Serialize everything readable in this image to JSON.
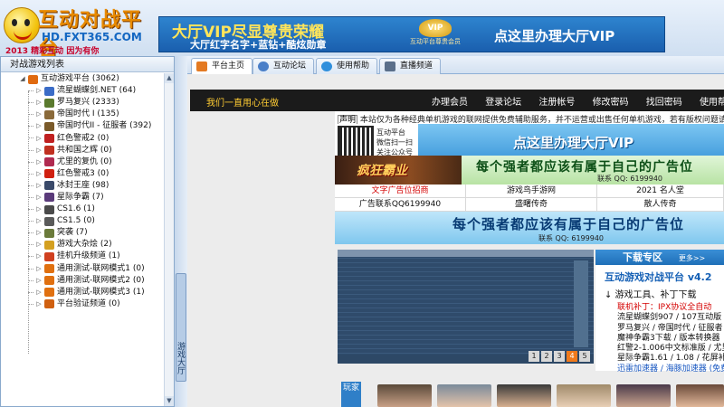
{
  "header": {
    "logo_title": "互动对战平台",
    "logo_domain": "HD.FXT365.COM",
    "logo_slogan": "2013 精彩互动 因为有你",
    "banner_line1": "大厅VIP尽显尊贵荣耀",
    "banner_line2": "大厅红字名字+蓝钻+酷炫勋章",
    "banner_badge_text": "互动平台尊贵会员",
    "banner_badge_mark": "VIP",
    "banner_cta": "点这里办理大厅VIP"
  },
  "left_pane": {
    "title": "对战游戏列表",
    "strip_label": "游戏大厅",
    "root": {
      "label": "互动游戏平台 (3062)"
    },
    "items": [
      {
        "label": "流星蝴蝶剑.NET (64)",
        "icon": "sword-icon",
        "color": "#3b6cc7"
      },
      {
        "label": "罗马复兴 (2333)",
        "icon": "shield-icon",
        "color": "#5a7a2e"
      },
      {
        "label": "帝国时代 I (135)",
        "icon": "castle-icon",
        "color": "#8a6a3a"
      },
      {
        "label": "帝国时代II - 征服者 (392)",
        "icon": "castle-icon",
        "color": "#7a5a2a"
      },
      {
        "label": "红色警戒2 (0)",
        "icon": "flag-icon",
        "color": "#c02020"
      },
      {
        "label": "共和国之辉 (0)",
        "icon": "star-icon",
        "color": "#c03020"
      },
      {
        "label": "尤里的复仇 (0)",
        "icon": "flag-icon",
        "color": "#b02a50"
      },
      {
        "label": "红色警戒3 (0)",
        "icon": "flag-icon",
        "color": "#d02010"
      },
      {
        "label": "冰封王座 (98)",
        "icon": "warcraft-icon",
        "color": "#3a4a6a"
      },
      {
        "label": "星际争霸 (7)",
        "icon": "starcraft-icon",
        "color": "#5a3a7a"
      },
      {
        "label": "CS1.6 (1)",
        "icon": "cs-icon",
        "color": "#4a4a4a"
      },
      {
        "label": "CS1.5 (0)",
        "icon": "cs-icon",
        "color": "#5a5a5a"
      },
      {
        "label": "突袭 (7)",
        "icon": "tank-icon",
        "color": "#6a7a3a"
      },
      {
        "label": "游戏大杂烩 (2)",
        "icon": "folder-icon",
        "color": "#d4a020"
      },
      {
        "label": "挂机升级频道 (1)",
        "icon": "level-icon",
        "color": "#d04020"
      },
      {
        "label": "通用测试-联网模式1 (0)",
        "icon": "test-icon",
        "color": "#e07010"
      },
      {
        "label": "通用测试-联网模式2 (0)",
        "icon": "test-icon",
        "color": "#e07010"
      },
      {
        "label": "通用测试-联网模式3 (1)",
        "icon": "test-icon",
        "color": "#e07010"
      },
      {
        "label": "平台验证频道 (0)",
        "icon": "verify-icon",
        "color": "#d06010"
      }
    ]
  },
  "tabs": [
    {
      "label": "平台主页",
      "icon": "home-icon"
    },
    {
      "label": "互动论坛",
      "icon": "forum-icon"
    },
    {
      "label": "使用帮助",
      "icon": "help-icon"
    },
    {
      "label": "直播频道",
      "icon": "tv-icon"
    }
  ],
  "web": {
    "motto": "我们一直用心在做",
    "nav_links": [
      "办理会员",
      "登录论坛",
      "注册帐号",
      "修改密码",
      "找回密码",
      "使用帮助"
    ],
    "notice_tag": "声明",
    "notice_text": "本站仅为各种经典单机游戏的联网提供免费辅助服务，并不运营或出售任何单机游戏，若有版权问题请联系我们",
    "qr_text": [
      "互动平台",
      "微信扫一扫",
      "关注公众号"
    ],
    "vip_small": "点这里办理大厅VIP",
    "game_ad": "疯狂霸业",
    "ad_slogan": "每个强者都应该有属于自己的广告位",
    "ad_contact": "联系 QQ: 6199940",
    "ad_slogan2": "每个强者都应该有属于自己的广告位",
    "ad_contact2": "联系 QQ: 6199940",
    "links": [
      [
        "文字广告位招商",
        "游戏鸟手游网",
        "2021 名人堂"
      ],
      [
        "广告联系QQ6199940",
        "盛曙传奇",
        "散人传奇"
      ]
    ],
    "pages": [
      "1",
      "2",
      "3",
      "4",
      "5"
    ],
    "active_page": "4",
    "download": {
      "head": "下载专区",
      "more": "更多>>",
      "title": "互动游戏对战平台 v4.2",
      "subtitle": "↓ 游戏工具、补丁下载",
      "items": [
        "联机补丁：IPX协议全自动",
        "流星蝴蝶剑907 / 107互动版",
        "罗马复兴 / 帝国时代 / 征服者",
        "魔神争霸3下载 / 版本转换器",
        "红警2-1.006中文标准版 / 尤里",
        "星际争霸1.61 / 1.08 / 花屏补丁",
        "迅雷加速器 / 海豚加速器 (免费)"
      ]
    },
    "players_label": "玩家"
  },
  "colors": {
    "accent": "#1f6fb8",
    "nav_bg": "#1b1b1b",
    "motto": "#ffcc33",
    "active_page": "#f07a1c"
  }
}
